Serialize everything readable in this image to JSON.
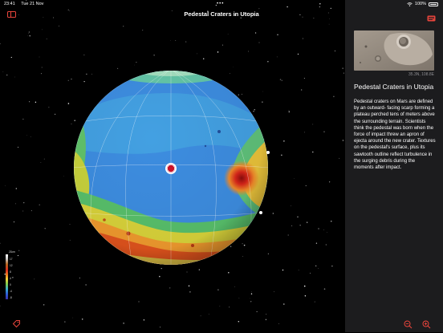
{
  "status": {
    "time": "23:41",
    "date": "Tue 21 Nov",
    "dots": "•••",
    "battery": "100%"
  },
  "map": {
    "title": "Pedestal Craters in Utopia"
  },
  "legend": {
    "unit": "21km",
    "ticks": [
      "17",
      "12",
      "8",
      "4",
      "0",
      "-4",
      "-8"
    ]
  },
  "panel": {
    "coordinates": "35.3N, 108.8E",
    "title": "Pedestal Craters in Utopia",
    "body": "Pedestal craters on Mars are defined by an outward- facing scarp forming a plateau perched tens of meters above the surrounding terrain. Scientists think the pedestal was born when the force of impact threw an apron of ejecta around the new crater. Textures on the pedestal's surface, plus its sawtooth outline reflect turbulence in the surging debris during the moments after impact."
  },
  "colors": {
    "accent": "#e8453c",
    "panel_bg": "#1c1c1e",
    "ocean_blue": "#3d8de0",
    "highland_red": "#e0531d"
  },
  "icons": [
    "sidebar-icon",
    "wifi-icon",
    "battery-icon",
    "tag-icon",
    "info-card-icon",
    "zoom-out-icon",
    "zoom-in-icon"
  ]
}
